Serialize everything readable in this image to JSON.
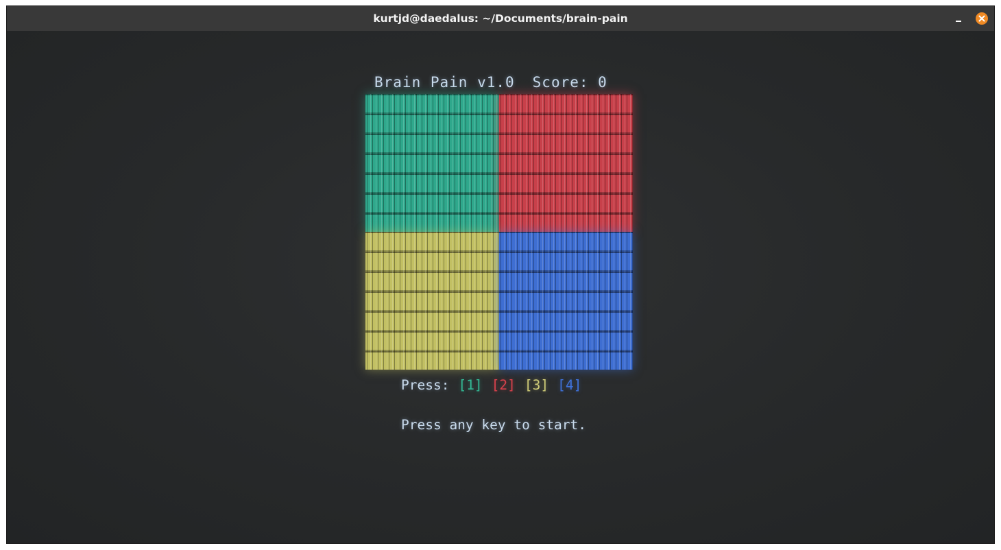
{
  "window": {
    "title": "kurtjd@daedalus: ~/Documents/brain-pain"
  },
  "game": {
    "title": "Brain Pain v1.0",
    "score_label": "Score: 0",
    "quadrants": [
      {
        "key": "1",
        "color": "#2fa88c"
      },
      {
        "key": "2",
        "color": "#c8404a"
      },
      {
        "key": "3",
        "color": "#c2c063"
      },
      {
        "key": "4",
        "color": "#3e6ed2"
      }
    ],
    "press_label": "Press:",
    "keys": [
      "[1]",
      "[2]",
      "[3]",
      "[4]"
    ],
    "start_message": "Press any key to start."
  },
  "icons": {
    "minimize": "minimize-icon",
    "close": "close-icon"
  },
  "colors": {
    "titlebar": "#393939",
    "terminal_bg": "#262829",
    "close_button": "#f08a24",
    "text": "#c8daec"
  }
}
